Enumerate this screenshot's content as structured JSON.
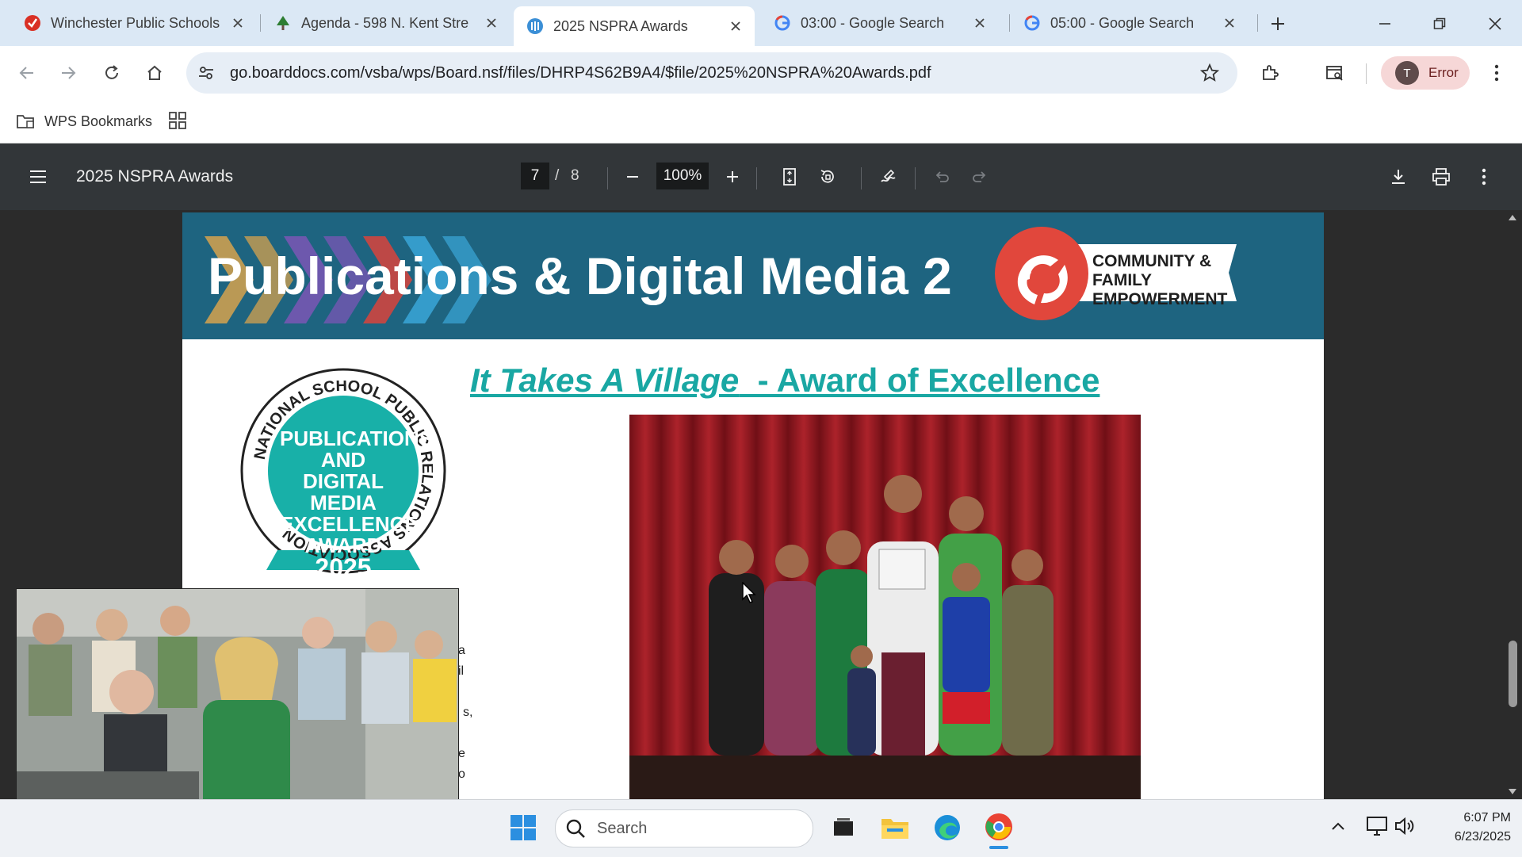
{
  "browser": {
    "tabs": [
      {
        "title": "Winchester Public Schools",
        "icon": "winchester-favicon"
      },
      {
        "title": "Agenda - 598 N. Kent Stre",
        "icon": "tree-favicon"
      },
      {
        "title": "2025 NSPRA Awards",
        "icon": "boarddocs-favicon",
        "active": true
      },
      {
        "title": "03:00 - Google Search",
        "icon": "google-favicon"
      },
      {
        "title": "05:00 - Google Search",
        "icon": "google-favicon"
      }
    ],
    "url": "go.boarddocs.com/vsba/wps/Board.nsf/files/DHRP4S62B9A4/$file/2025%20NSPRA%20Awards.pdf",
    "profile_initial": "T",
    "profile_label": "Error",
    "bookmark_label": "WPS Bookmarks"
  },
  "pdf": {
    "title": "2025 NSPRA Awards",
    "current_page": "7",
    "page_sep": "/",
    "total_pages": "8",
    "zoom": "100%"
  },
  "slide": {
    "banner_title": "Publications & Digital Media 2",
    "cfe_line1": "COMMUNITY & FAMILY",
    "cfe_line2": "EMPOWERMENT",
    "award_title_italic": "It Takes A Village",
    "award_title_rest": "  - Award of Excellence",
    "badge_ring_text": "NATIONAL SCHOOL PUBLIC RELATIONS ASSOCIATION",
    "badge_line1": "PUBLICATIONS",
    "badge_line2": "AND DIGITAL",
    "badge_line3": "MEDIA",
    "badge_line4": "EXCELLENCE",
    "badge_line5": "AWARD",
    "badge_year": "2025",
    "peek_text": [
      "a",
      "il",
      "s,",
      "e",
      "o"
    ]
  },
  "taskbar": {
    "search_placeholder": "Search",
    "time": "6:07 PM",
    "date": "6/23/2025"
  },
  "colors": {
    "banner": "#1e6480",
    "award_teal": "#19a7a3",
    "cfe_red": "#e1473c",
    "pdf_toolbar": "#323639",
    "tabstrip": "#dbe8f5"
  }
}
